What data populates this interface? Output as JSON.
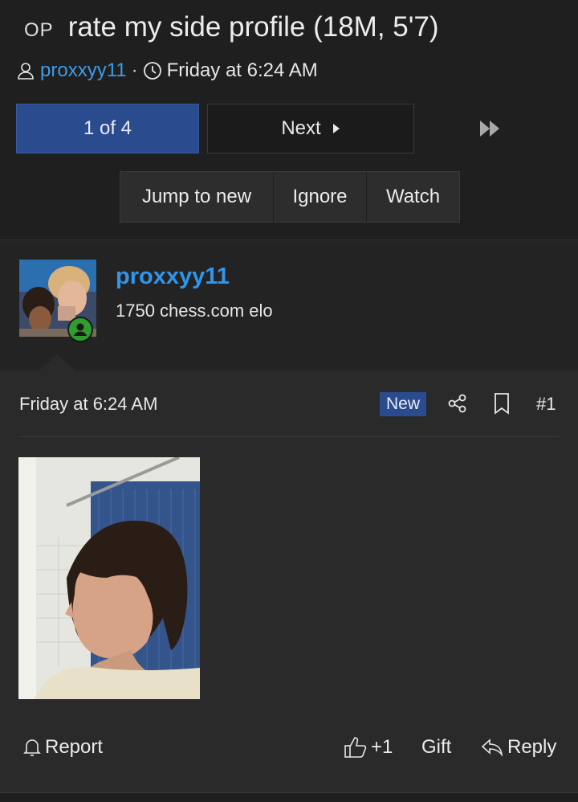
{
  "thread": {
    "op_badge": "OP",
    "title": "rate my side profile (18M, 5'7)",
    "author": "proxxyy11",
    "separator": "·",
    "date": "Friday at 6:24 AM"
  },
  "pagination": {
    "current": "1 of 4",
    "next_label": "Next"
  },
  "thread_actions": [
    {
      "label": "Jump to new"
    },
    {
      "label": "Ignore"
    },
    {
      "label": "Watch"
    }
  ],
  "post": {
    "username": "proxxyy11",
    "user_title": "1750 chess.com elo",
    "date": "Friday at 6:24 AM",
    "new_badge": "New",
    "number": "#1",
    "actions": {
      "report": "Report",
      "like_count": "+1",
      "gift": "Gift",
      "reply": "Reply"
    }
  },
  "icons": [
    "user-icon",
    "clock-icon",
    "caret-right-icon",
    "fast-forward-icon",
    "share-icon",
    "bookmark-icon",
    "bell-icon",
    "thumbs-up-icon",
    "reply-icon",
    "online-status-icon"
  ],
  "colors": {
    "accent": "#2b4b8f",
    "link": "#3d9ae8",
    "username": "#2f96ea",
    "online": "#2e9d2e",
    "background": "#232323"
  }
}
